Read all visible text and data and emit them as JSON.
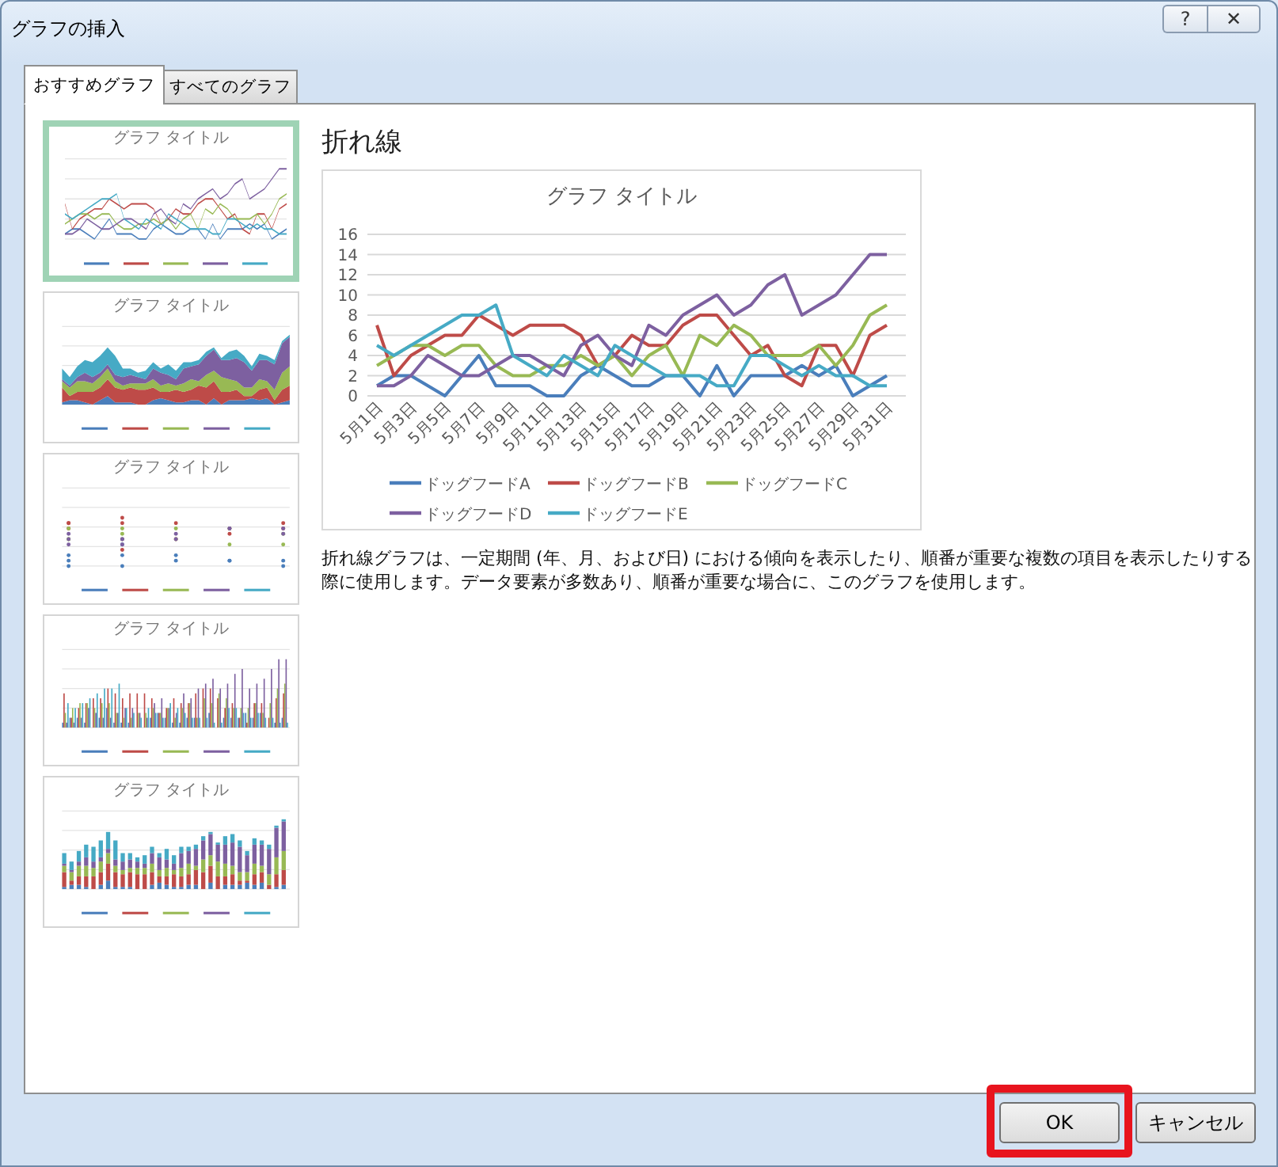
{
  "window": {
    "title": "グラフの挿入",
    "help_button": "?",
    "close_button": "✕"
  },
  "tabs": [
    {
      "label": "おすすめグラフ",
      "selected": true
    },
    {
      "label": "すべてのグラフ",
      "selected": false
    }
  ],
  "thumbnails": [
    {
      "kind": "line",
      "title": "グラフ タイトル",
      "selected": true
    },
    {
      "kind": "area",
      "title": "グラフ タイトル",
      "selected": false
    },
    {
      "kind": "scatter",
      "title": "グラフ タイトル",
      "selected": false
    },
    {
      "kind": "column",
      "title": "グラフ タイトル",
      "selected": false
    },
    {
      "kind": "stacked_column",
      "title": "グラフ タイトル",
      "selected": false
    }
  ],
  "preview": {
    "heading": "折れ線",
    "chart_data": {
      "type": "line",
      "title": "グラフ タイトル",
      "categories": [
        "5月1日",
        null,
        "5月3日",
        null,
        "5月5日",
        null,
        "5月7日",
        null,
        "5月9日",
        null,
        "5月11日",
        null,
        "5月13日",
        null,
        "5月15日",
        null,
        "5月17日",
        null,
        "5月19日",
        null,
        "5月21日",
        null,
        "5月23日",
        null,
        "5月25日",
        null,
        "5月27日",
        null,
        "5月29日",
        null,
        "5月31日"
      ],
      "ylim": [
        0,
        16
      ],
      "yticks": [
        0,
        2,
        4,
        6,
        8,
        10,
        12,
        14,
        16
      ],
      "grid": true,
      "legend": "bottom",
      "series": [
        {
          "name": "ドッグフードA",
          "color": "#4a7ebb",
          "values": [
            1,
            2,
            2,
            1,
            0,
            2,
            4,
            1,
            1,
            1,
            0,
            0,
            2,
            3,
            2,
            1,
            1,
            2,
            2,
            0,
            3,
            0,
            2,
            2,
            2,
            3,
            2,
            3,
            0,
            1,
            2
          ]
        },
        {
          "name": "ドッグフードB",
          "color": "#be4b48",
          "values": [
            7,
            2,
            4,
            5,
            6,
            6,
            8,
            7,
            6,
            7,
            7,
            7,
            6,
            3,
            4,
            6,
            5,
            5,
            7,
            8,
            8,
            6,
            4,
            5,
            2,
            1,
            5,
            5,
            2,
            6,
            7
          ]
        },
        {
          "name": "ドッグフードC",
          "color": "#98b954",
          "values": [
            3,
            4,
            5,
            5,
            4,
            5,
            5,
            3,
            2,
            2,
            3,
            3,
            4,
            3,
            4,
            2,
            4,
            5,
            2,
            6,
            5,
            7,
            6,
            4,
            4,
            4,
            5,
            3,
            5,
            8,
            9
          ]
        },
        {
          "name": "ドッグフードD",
          "color": "#7d60a0",
          "values": [
            1,
            1,
            2,
            4,
            3,
            2,
            2,
            3,
            4,
            4,
            3,
            2,
            5,
            6,
            4,
            3,
            7,
            6,
            8,
            9,
            10,
            8,
            9,
            11,
            12,
            8,
            9,
            10,
            12,
            14,
            14
          ]
        },
        {
          "name": "ドッグフードE",
          "color": "#46aac5",
          "values": [
            5,
            4,
            5,
            6,
            7,
            8,
            8,
            9,
            4,
            3,
            2,
            4,
            3,
            2,
            5,
            4,
            3,
            2,
            2,
            2,
            1,
            1,
            4,
            4,
            3,
            2,
            3,
            2,
            2,
            1,
            1
          ]
        }
      ]
    },
    "description": "折れ線グラフは、一定期間 (年、月、および日) における傾向を表示したり、順番が重要な複数の項目を表示したりする際に使用します。データ要素が多数あり、順番が重要な場合に、このグラフを使用します。"
  },
  "buttons": [
    {
      "label": "OK",
      "highlighted": true
    },
    {
      "label": "キャンセル",
      "highlighted": false
    }
  ]
}
